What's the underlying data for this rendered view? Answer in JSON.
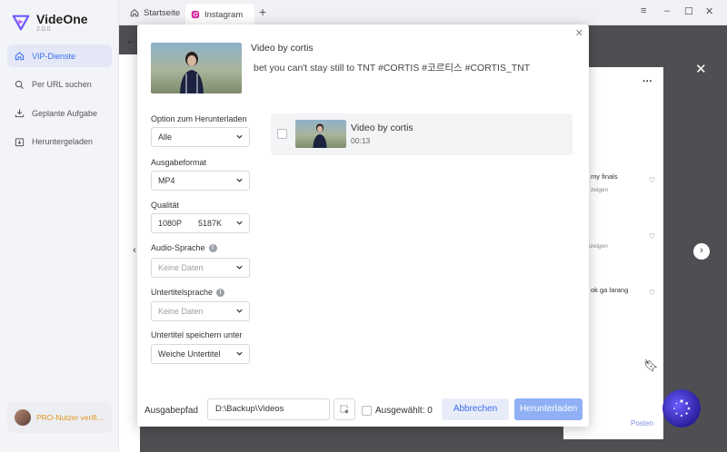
{
  "app": {
    "name": "VideOne",
    "version": "2.0.0"
  },
  "sidebar": {
    "items": [
      {
        "label": "VIP-Dienste",
        "icon": "home-icon",
        "active": true
      },
      {
        "label": "Per URL suchen",
        "icon": "search-icon"
      },
      {
        "label": "Geplante Aufgabe",
        "icon": "download-tray-icon"
      },
      {
        "label": "Heruntergeladen",
        "icon": "downloaded-icon"
      }
    ],
    "pro_label": "PRO-Nutzer verifi..."
  },
  "tabs": [
    {
      "label": "Startseite",
      "icon": "home-icon"
    },
    {
      "label": "Instagram",
      "icon": "instagram-icon"
    }
  ],
  "background": {
    "comments": [
      {
        "text": "my finals",
        "sub": "zeigen"
      },
      {
        "text": "",
        "sub": "nzeigen"
      },
      {
        "text": "ok ga larang",
        "sub": ""
      }
    ],
    "posten_label": "Posten"
  },
  "dialog": {
    "video_title": "Video by cortis",
    "video_desc": "bet you can't stay still to TNT #CORTIS #코르티스 #CORTIS_TNT",
    "options": {
      "download_option": {
        "label": "Option zum Herunterladen",
        "value": "Alle"
      },
      "output_format": {
        "label": "Ausgabeformat",
        "value": "MP4"
      },
      "quality": {
        "label": "Qualität",
        "value": "1080P",
        "size": "5187K"
      },
      "audio_lang": {
        "label": "Audio-Sprache",
        "value": "Keine Daten"
      },
      "subtitle_lang": {
        "label": "Untertitelsprache",
        "value": "Keine Daten"
      },
      "subtitle_save": {
        "label": "Untertitel speichern unter",
        "value": "Weiche Untertitel"
      }
    },
    "item": {
      "title": "Video by cortis",
      "duration": "00:13",
      "checked": false
    },
    "footer": {
      "path_label": "Ausgabepfad",
      "path_value": "D:\\Backup\\Videos",
      "selected_label": "Ausgewählt: 0",
      "cancel_label": "Abbrechen",
      "download_label": "Herunterladen"
    }
  },
  "colors": {
    "accent": "#3a6df0",
    "pro": "#e3951e",
    "download_btn": "#8fb0f4"
  }
}
